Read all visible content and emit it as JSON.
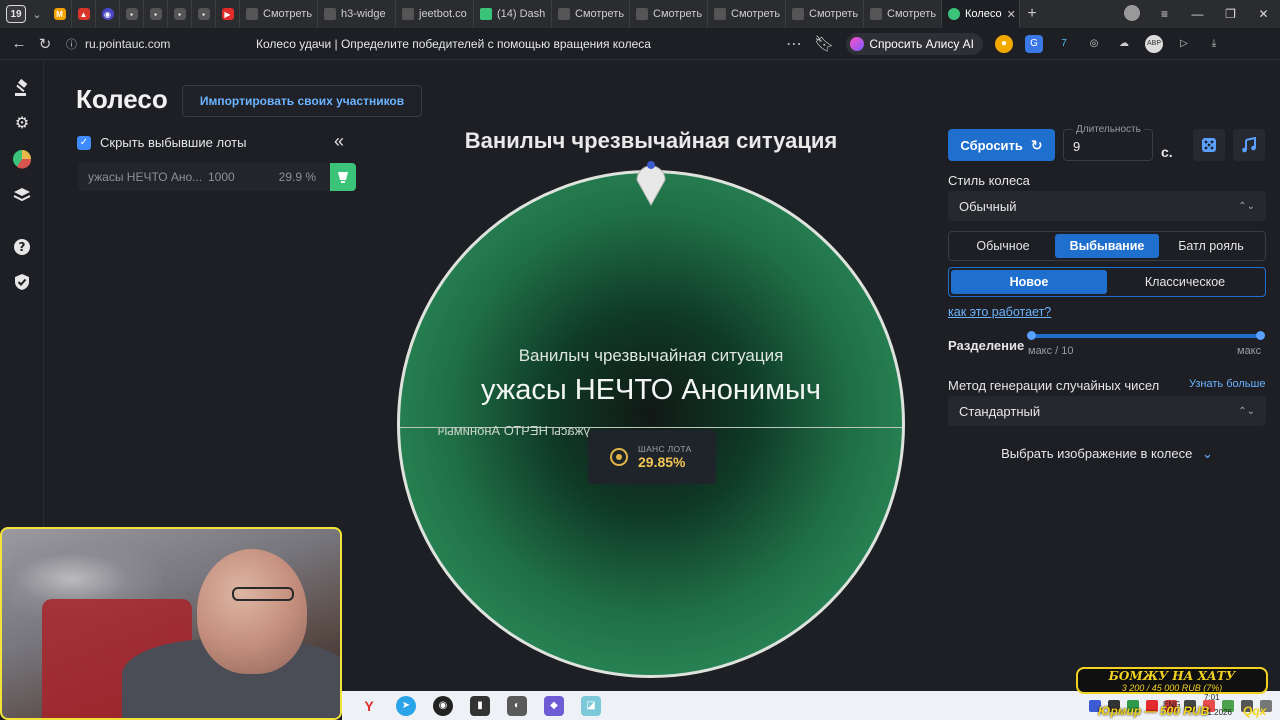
{
  "browser": {
    "tab_count": "19",
    "tabs": [
      {
        "label": "Смотреть"
      },
      {
        "label": "h3-widge"
      },
      {
        "label": "jeetbot.co"
      },
      {
        "label": "(14) Dash"
      },
      {
        "label": "Смотреть"
      },
      {
        "label": "Смотреть"
      },
      {
        "label": "Смотреть"
      },
      {
        "label": "Смотреть"
      },
      {
        "label": "Смотреть"
      },
      {
        "label": "Колесо"
      }
    ],
    "url": "ru.pointauc.com",
    "page_title": "Колесо удачи | Определите победителей с помощью вращения колеса",
    "alice_label": "Спросить Алису AI"
  },
  "header": {
    "title": "Колесо",
    "import_label": "Импортировать своих участников"
  },
  "participants": {
    "hide_label": "Скрыть выбывшие лоты",
    "hide_checked": true,
    "lots": [
      {
        "name": "ужасы НЕЧТО Ано...",
        "amount": "1000",
        "percent": "29.9 %"
      }
    ]
  },
  "wheel": {
    "title": "Ванилыч чрезвычайная ситуация",
    "subtitle": "Ванилыч чрезвычайная ситуация",
    "winner": "ужасы НЕЧТО Анонимыч",
    "mirror_text": "ужасы НЕЧТО Анонимыч",
    "chance_label": "ШАНС ЛОТА",
    "chance_value": "29.85%",
    "segment_color": "#2a8a59"
  },
  "settings": {
    "reset_label": "Сбросить",
    "duration_label": "Длительность",
    "duration_value": "9",
    "duration_unit": "с.",
    "style_label": "Стиль колеса",
    "style_value": "Обычный",
    "modes": [
      "Обычное",
      "Выбывание",
      "Батл рояль"
    ],
    "mode_selected": "Выбывание",
    "variants": [
      "Новое",
      "Классическое"
    ],
    "variant_selected": "Новое",
    "help_link": "как это работает?",
    "split_label": "Разделение",
    "split_min_label": "макс / 10",
    "split_max_label": "макс",
    "rng_label": "Метод генерации случайных чисел",
    "rng_more": "Узнать больше",
    "rng_value": "Стандартный",
    "image_pick_label": "Выбрать изображение в колесе",
    "accent": "#1f6fcf"
  },
  "overlay": {
    "donation_title": "БОМЖУ НА ХАТУ",
    "donation_sub": "3 200 / 45 000 RUB (7%)",
    "donor": "Юрмир — 500 RUB",
    "tag": "Qqx",
    "lang": "ENG",
    "time": "7:01",
    "date": "01.2026"
  }
}
